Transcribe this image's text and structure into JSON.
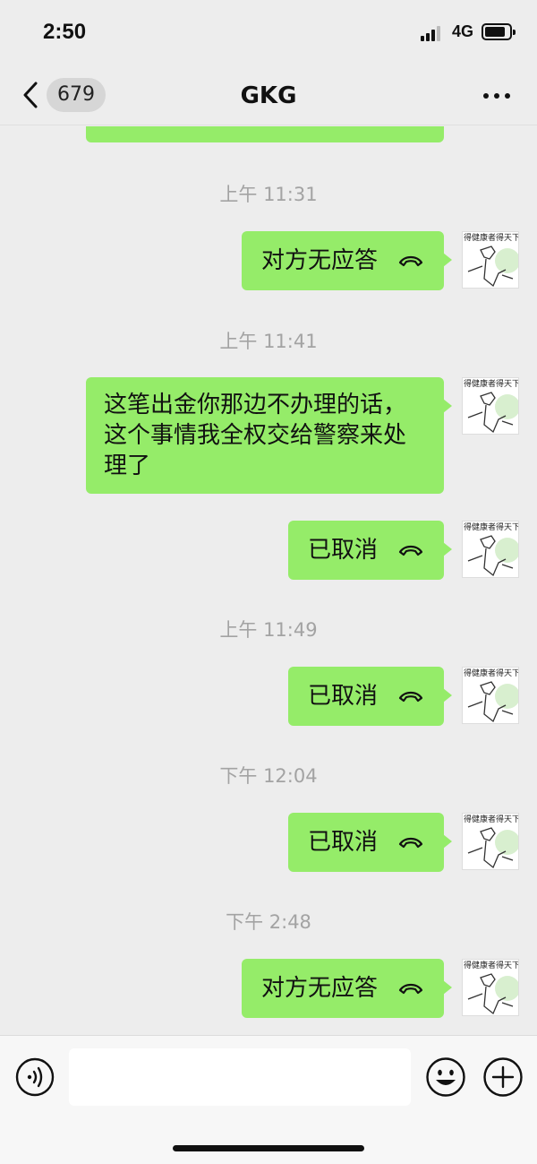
{
  "status": {
    "time": "2:50",
    "network": "4G"
  },
  "nav": {
    "back_count": "679",
    "title": "GKG"
  },
  "avatar_caption": "得健康者得天下",
  "messages": [
    {
      "timestamp": "上午 11:31",
      "text": "对方无应答"
    },
    {
      "timestamp": "上午 11:41",
      "text": "这笔出金你那边不办理的话，这个事情我全权交给警察来处理了"
    },
    {
      "text": "已取消"
    },
    {
      "timestamp": "上午 11:49",
      "text": "已取消"
    },
    {
      "timestamp": "下午 12:04",
      "text": "已取消"
    },
    {
      "timestamp": "下午 2:48",
      "text": "对方无应答"
    }
  ],
  "icons": {
    "back": "chevron-left-icon",
    "more": "more-dots-icon",
    "call": "hangup-phone-icon",
    "voice": "voice-icon",
    "emoji": "emoji-icon",
    "add": "plus-icon"
  },
  "colors": {
    "bubble": "#95ec69",
    "background": "#ededed",
    "timestamp": "#a3a3a3"
  }
}
